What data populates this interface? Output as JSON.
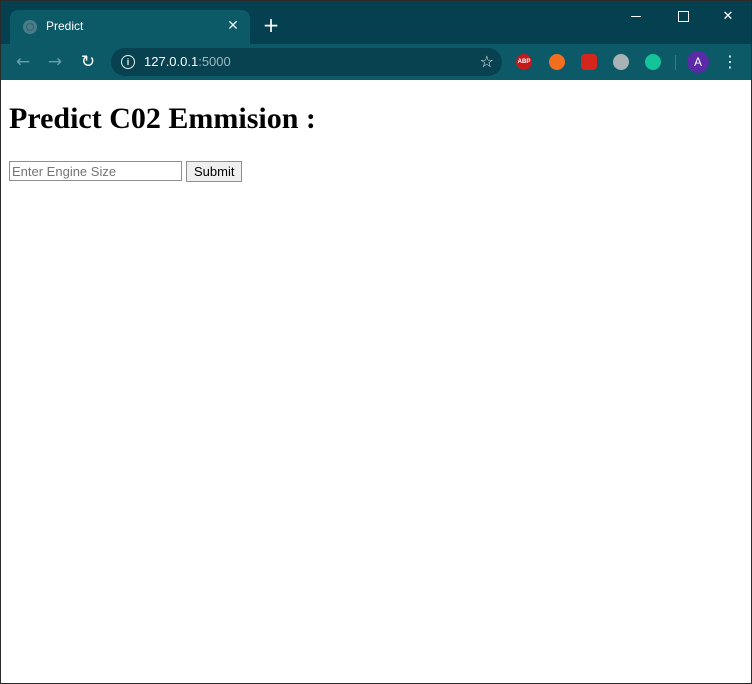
{
  "browser": {
    "tab": {
      "title": "Predict",
      "close_symbol": "✕"
    },
    "new_tab_symbol": "+",
    "window_controls": {
      "close_symbol": "✕"
    },
    "nav": {
      "back_symbol": "←",
      "forward_symbol": "→",
      "reload_symbol": "↻"
    },
    "address": {
      "host": "127.0.0.1",
      "port": ":5000",
      "info_symbol": "i",
      "star_symbol": "☆"
    },
    "extensions": {
      "abp_label": "ABP",
      "icons": [
        "adblock-plus-icon",
        "firefox-relay-icon",
        "hand-block-icon",
        "drop-icon",
        "grammarly-icon"
      ]
    },
    "profile_initial": "A",
    "menu_symbol": "⋮"
  },
  "page": {
    "heading": "Predict C02 Emmision :",
    "input": {
      "placeholder": "Enter Engine Size",
      "value": ""
    },
    "submit_label": "Submit"
  },
  "colors": {
    "titlebar": "#04404f",
    "toolbar": "#0c5968",
    "omnibox": "#08414f",
    "avatar": "#5b2aa6"
  }
}
